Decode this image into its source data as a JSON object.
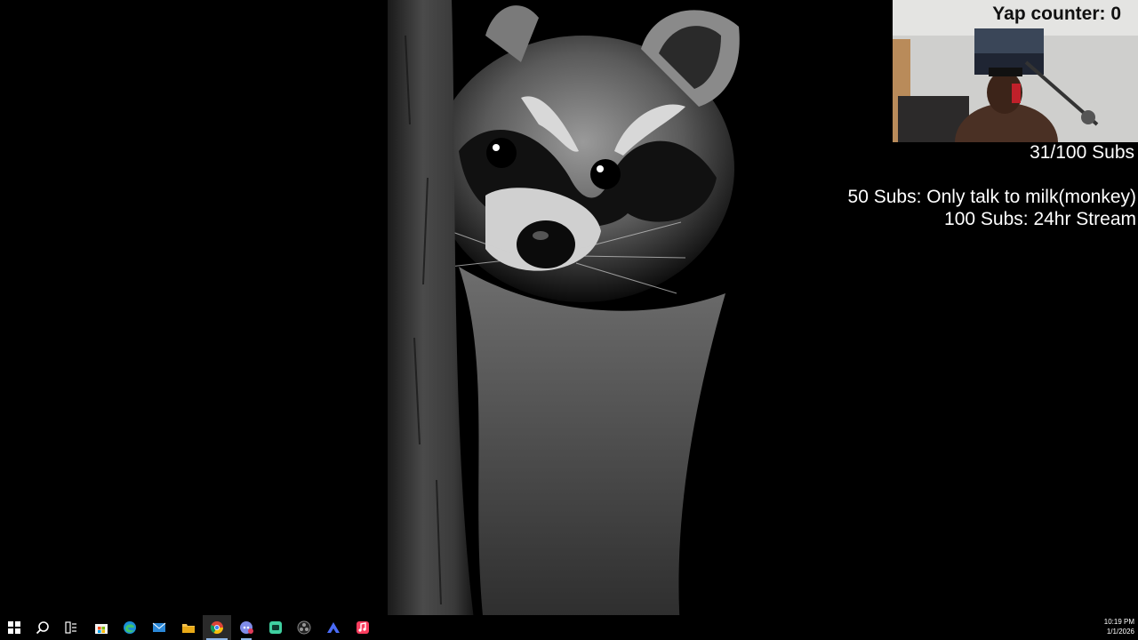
{
  "overlay": {
    "yap_counter": "Yap counter: 0",
    "subs_progress": "31/100 Subs",
    "goals": [
      "50 Subs: Only talk to milk(monkey)",
      "100 Subs: 24hr Stream"
    ]
  },
  "taskbar": {
    "items": [
      {
        "name": "start-button",
        "icon": "windows-logo-icon"
      },
      {
        "name": "search-button",
        "icon": "search-icon"
      },
      {
        "name": "task-view-button",
        "icon": "task-view-icon"
      },
      {
        "name": "store-button",
        "icon": "microsoft-store-icon"
      },
      {
        "name": "edge-button",
        "icon": "edge-icon"
      },
      {
        "name": "mail-button",
        "icon": "mail-icon"
      },
      {
        "name": "file-explorer-button",
        "icon": "folder-icon"
      },
      {
        "name": "chrome-button",
        "icon": "chrome-icon",
        "state": "active"
      },
      {
        "name": "discord-button",
        "icon": "discord-icon",
        "state": "running"
      },
      {
        "name": "app-button",
        "icon": "app-icon"
      },
      {
        "name": "obs-button",
        "icon": "obs-icon"
      },
      {
        "name": "vpn-button",
        "icon": "vpn-icon"
      },
      {
        "name": "itunes-button",
        "icon": "music-icon"
      }
    ],
    "clock": {
      "time": "10:19 PM",
      "date": "1/1/2026"
    }
  },
  "colors": {
    "taskbar_bg": "#000000",
    "accent": "#8fb7e8",
    "overlay_text": "#ffffff",
    "yap_text": "#111111"
  }
}
